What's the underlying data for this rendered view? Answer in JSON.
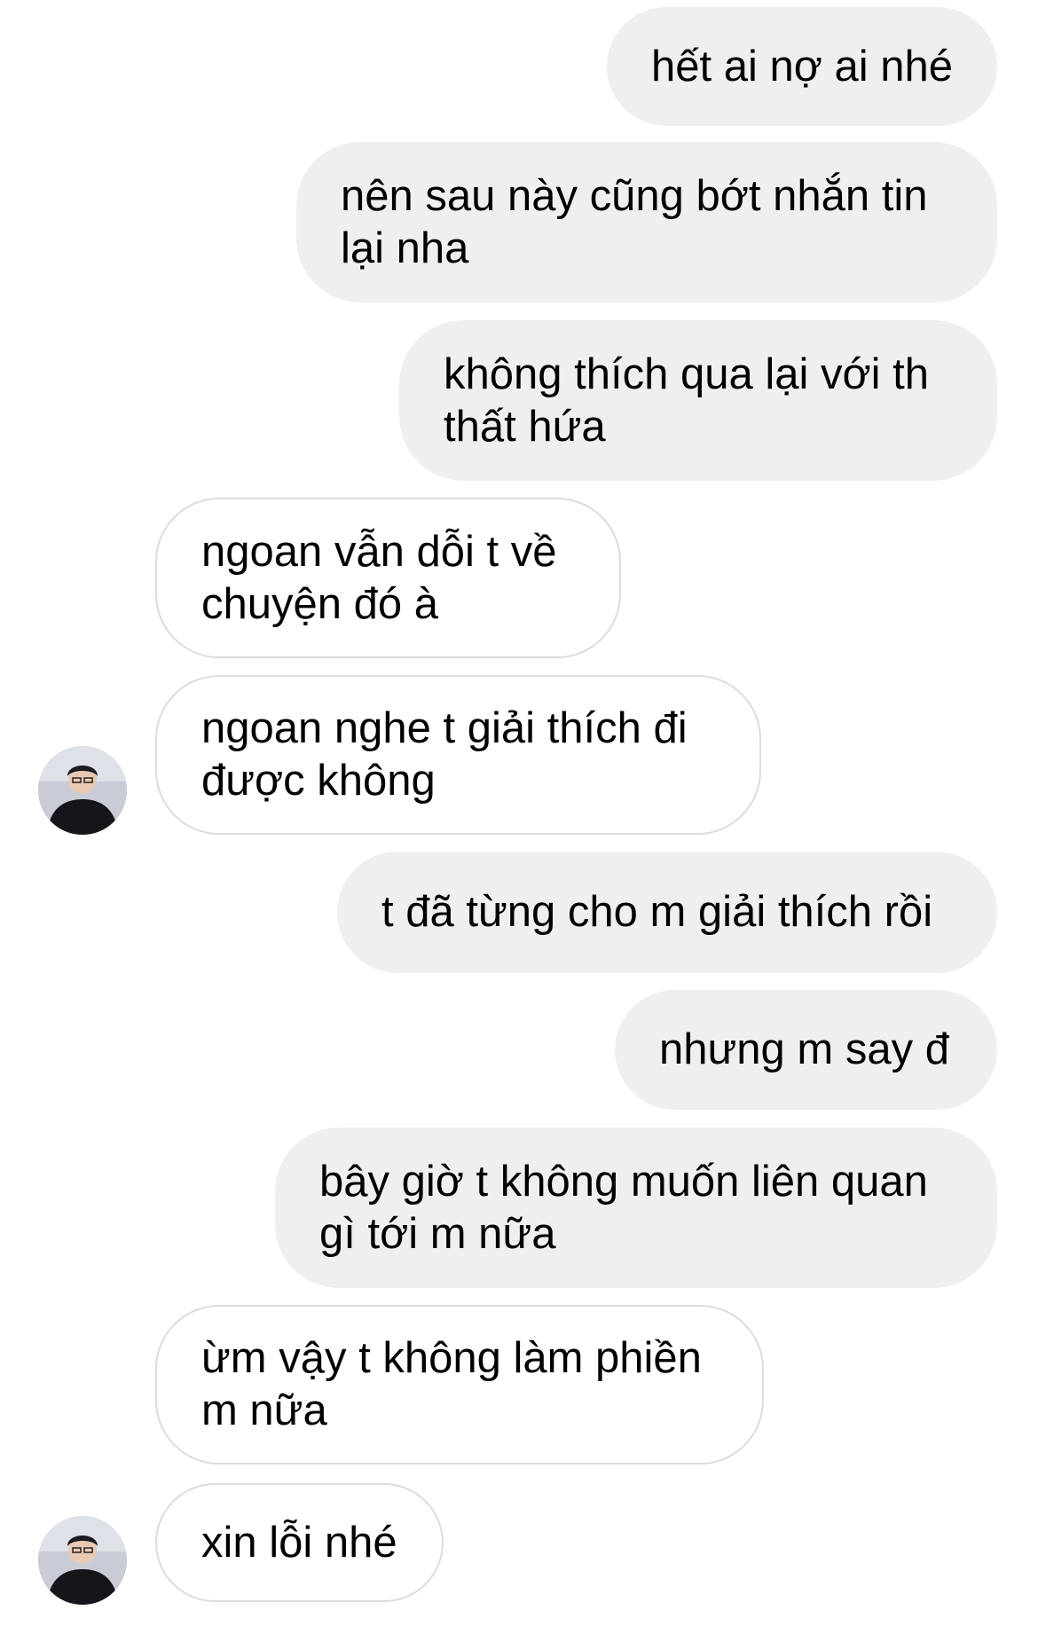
{
  "messages": [
    {
      "sender": "me",
      "text": "hết ai nợ ai nhé"
    },
    {
      "sender": "me",
      "text": "nên sau này cũng bớt nhắn tin\nlại nha"
    },
    {
      "sender": "me",
      "text": "không thích qua lại với th\nthất hứa"
    },
    {
      "sender": "other",
      "text": "ngoan vẫn dỗi t về\nchuyện đó à"
    },
    {
      "sender": "other",
      "text": "ngoan nghe t giải thích đi\nđược không"
    },
    {
      "sender": "me",
      "text": "t đã từng cho m giải thích rồi"
    },
    {
      "sender": "me",
      "text": "nhưng m say đ"
    },
    {
      "sender": "me",
      "text": "bây giờ t không muốn liên quan\ngì tới m nữa"
    },
    {
      "sender": "other",
      "text": "ừm vậy t không làm phiền\nm nữa"
    },
    {
      "sender": "other",
      "text": "xin lỗi nhé"
    }
  ],
  "colors": {
    "outgoing_bubble": "#efefef",
    "incoming_bubble": "#ffffff",
    "incoming_border": "#dcdcdc",
    "text": "#000000"
  },
  "avatar_icon": "user-photo-avatar"
}
